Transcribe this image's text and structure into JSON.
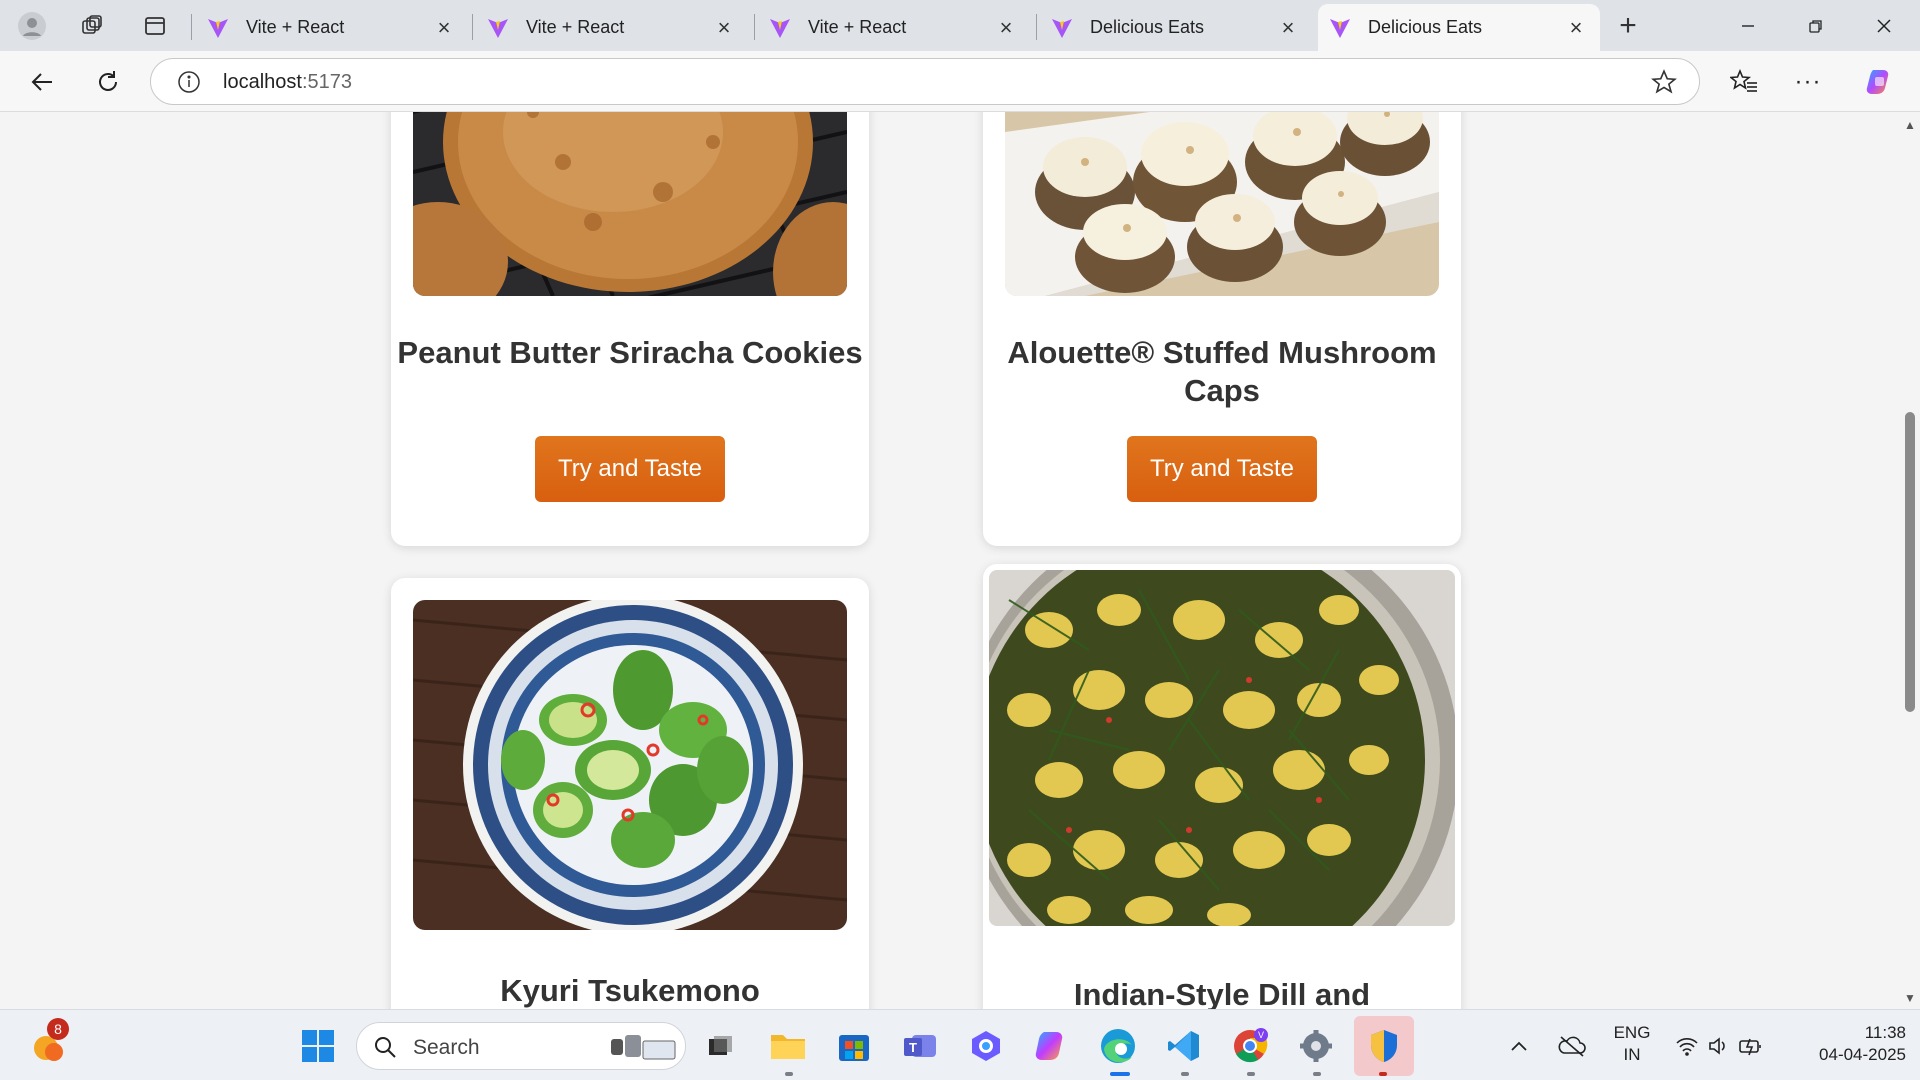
{
  "browser": {
    "tabs": [
      {
        "title": "Vite + React",
        "active": false
      },
      {
        "title": "Vite + React",
        "active": false
      },
      {
        "title": "Vite + React",
        "active": false
      },
      {
        "title": "Delicious Eats",
        "active": false
      },
      {
        "title": "Delicious Eats",
        "active": true
      }
    ],
    "new_tab_label": "+",
    "address": {
      "host": "localhost",
      "port": ":5173"
    }
  },
  "cards": [
    {
      "title": "Peanut Butter Sriracha Cookies",
      "button": "Try and Taste"
    },
    {
      "title": "Alouette® Stuffed Mushroom Caps",
      "button": "Try and Taste"
    },
    {
      "title": "Kyuri Tsukemono"
    },
    {
      "title": "Indian-Style Dill and Turmeric Potato Salad"
    }
  ],
  "taskbar": {
    "search_placeholder": "Search",
    "weather_badge": "8",
    "language": {
      "line1": "ENG",
      "line2": "IN"
    },
    "clock": {
      "time": "11:38",
      "date": "04-04-2025"
    }
  },
  "colors": {
    "accent": "#e06a18",
    "page_bg": "#f4f4f4",
    "card_bg": "#ffffff"
  }
}
